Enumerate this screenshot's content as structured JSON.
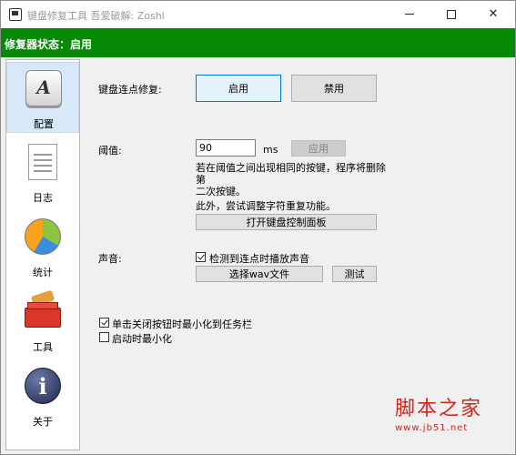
{
  "window": {
    "title": "键盘修复工具 吾爱破解: Zoshl"
  },
  "status": {
    "text": "修复器状态：启用",
    "bg_color": "#068a06"
  },
  "sidebar": {
    "items": [
      {
        "label": "配置",
        "icon": "keyboard-key-icon",
        "selected": true
      },
      {
        "label": "日志",
        "icon": "log-document-icon",
        "selected": false
      },
      {
        "label": "统计",
        "icon": "pie-chart-icon",
        "selected": false
      },
      {
        "label": "工具",
        "icon": "toolbox-icon",
        "selected": false
      },
      {
        "label": "关于",
        "icon": "info-icon",
        "selected": false
      }
    ],
    "key_icon_letter": "A",
    "info_icon_letter": "i"
  },
  "repair": {
    "label": "键盘连点修复:",
    "enable_label": "启用",
    "disable_label": "禁用"
  },
  "threshold": {
    "label": "阈值:",
    "value": "90",
    "unit": "ms",
    "apply_label": "应用",
    "desc_line1": "若在阈值之间出现相同的按键，程序将删除第",
    "desc_line2": "二次按键。",
    "extra_note": "此外，尝试调整字符重复功能。",
    "open_panel_label": "打开键盘控制面板"
  },
  "sound": {
    "label": "声音:",
    "play_on_detect_label": "检测到连点时播放声音",
    "play_on_detect_checked": true,
    "choose_wav_label": "选择wav文件",
    "test_label": "测试"
  },
  "options": {
    "minimize_on_close_label": "单击关闭按钮时最小化到任务栏",
    "minimize_on_close_checked": true,
    "start_minimized_label": "启动时最小化",
    "start_minimized_checked": false
  },
  "watermark": {
    "main": "脚本之家",
    "sub": "www.jb51.net"
  }
}
